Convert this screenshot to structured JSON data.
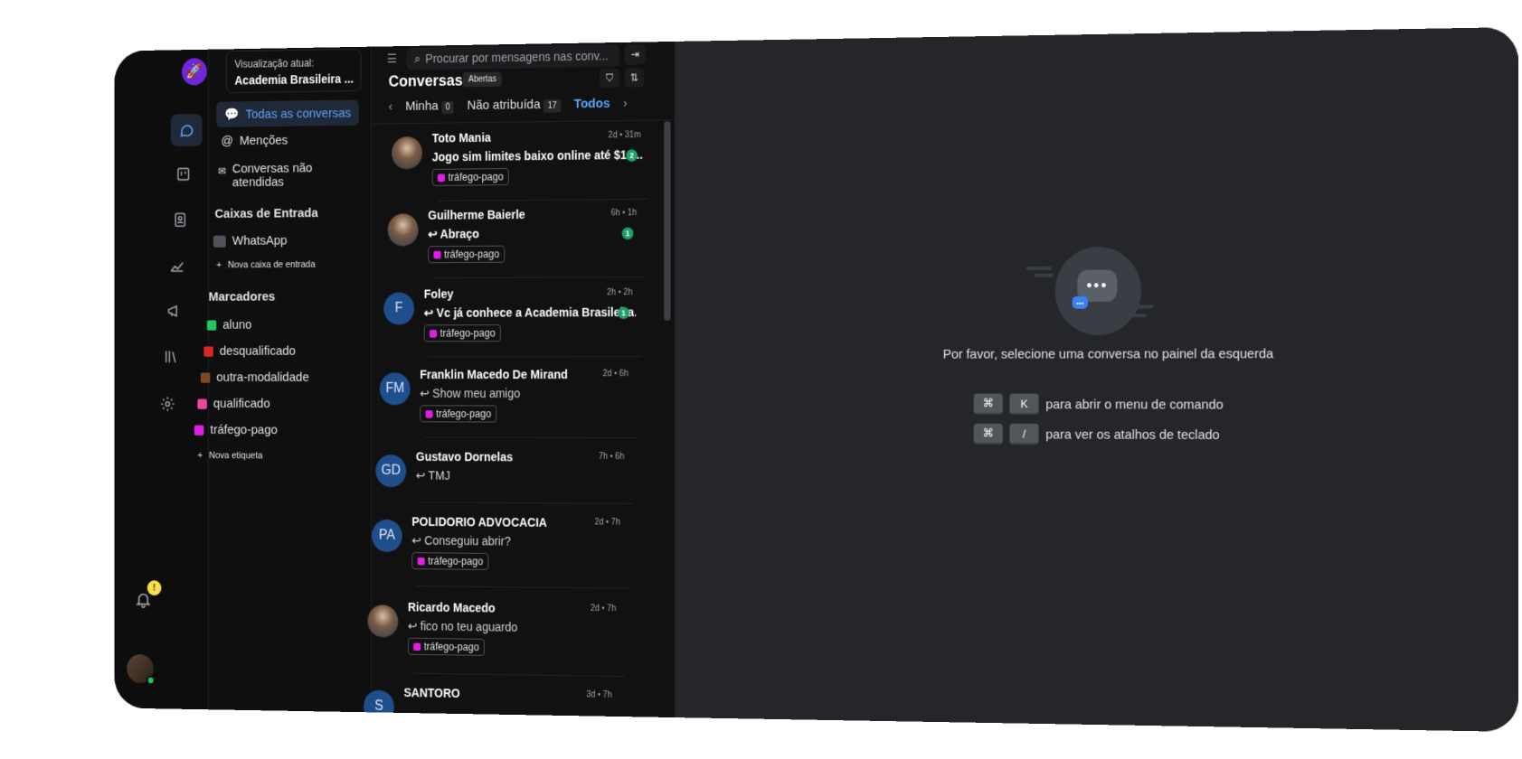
{
  "sidebar": {
    "view_label": "Visualização atual:",
    "view_value": "Academia Brasileira ...",
    "nav": {
      "all": "Todas as conversas",
      "mentions": "Menções",
      "unattended": "Conversas não atendidas"
    },
    "inboxes_title": "Caixas de Entrada",
    "inbox_whatsapp": "WhatsApp",
    "new_inbox": "Nova caixa de entrada",
    "labels_title": "Marcadores",
    "labels": [
      {
        "name": "aluno",
        "color": "#22c55e"
      },
      {
        "name": "desqualificado",
        "color": "#dc2626"
      },
      {
        "name": "outra-modalidade",
        "color": "#7c4a1e"
      },
      {
        "name": "qualificado",
        "color": "#ec4899"
      },
      {
        "name": "tráfego-pago",
        "color": "#e11de8"
      }
    ],
    "new_label": "Nova etiqueta",
    "notification_count": "!"
  },
  "list": {
    "search_placeholder": "Procurar por mensagens nas conv...",
    "title": "Conversas",
    "status": "Abertas",
    "tabs": {
      "mine": "Minha",
      "mine_count": "0",
      "unassigned": "Não atribuída",
      "unassigned_count": "17",
      "all": "Todos"
    },
    "conversations": [
      {
        "name": "Toto Mania",
        "time": "2d • 31m",
        "message": "Jogo sim limites baixo online até $10...",
        "unread": "2",
        "tag": "tráfego-pago",
        "initials": ""
      },
      {
        "name": "Guilherme Baierle",
        "time": "6h • 1h",
        "message": "↩ Abraço",
        "unread": "1",
        "tag": "tráfego-pago",
        "initials": ""
      },
      {
        "name": "Foley",
        "time": "2h • 2h",
        "message": "↩ Vc já conhece a Academia Brasileira...",
        "unread": "1",
        "tag": "tráfego-pago",
        "initials": "F"
      },
      {
        "name": "Franklin Macedo De Mirand",
        "time": "2d • 6h",
        "message": "↩ Show meu amigo",
        "unread": "",
        "tag": "tráfego-pago",
        "initials": "FM"
      },
      {
        "name": "Gustavo Dornelas",
        "time": "7h • 6h",
        "message": "↩ TMJ",
        "unread": "",
        "tag": "",
        "initials": "GD"
      },
      {
        "name": "POLIDORIO ADVOCACIA",
        "time": "2d • 7h",
        "message": "↩ Conseguiu abrir?",
        "unread": "",
        "tag": "tráfego-pago",
        "initials": "PA"
      },
      {
        "name": "Ricardo Macedo",
        "time": "2d • 7h",
        "message": "↩ fico no teu aguardo",
        "unread": "",
        "tag": "tráfego-pago",
        "initials": ""
      },
      {
        "name": "SANTORO",
        "time": "3d • 7h",
        "message": "",
        "unread": "",
        "tag": "",
        "initials": "S"
      }
    ]
  },
  "main": {
    "empty_text": "Por favor, selecione uma conversa no painel da esquerda",
    "shortcuts": [
      {
        "key1": "⌘",
        "key2": "K",
        "text": "para abrir o menu de comando"
      },
      {
        "key1": "⌘",
        "key2": "/",
        "text": "para ver os atalhos de teclado"
      }
    ]
  }
}
